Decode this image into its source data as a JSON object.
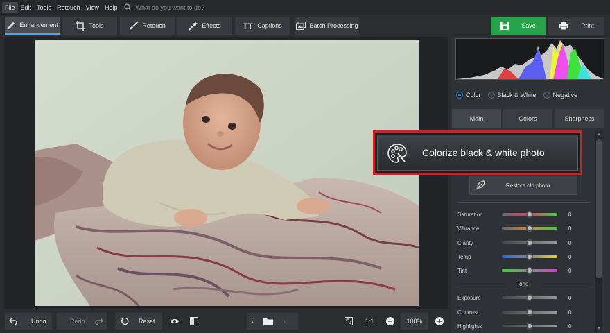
{
  "menubar": {
    "items": [
      "File",
      "Edit",
      "Tools",
      "Retouch",
      "View",
      "Help"
    ],
    "search_placeholder": "What do you want to do?"
  },
  "toolbar": {
    "tabs": [
      {
        "label": "Enhancement",
        "icon": "enhancement-icon",
        "active": true
      },
      {
        "label": "Tools",
        "icon": "crop-icon"
      },
      {
        "label": "Retouch",
        "icon": "brush-icon"
      },
      {
        "label": "Effects",
        "icon": "magic-wand-icon"
      },
      {
        "label": "Captions",
        "icon": "text-icon"
      }
    ],
    "batch_label": "Batch Processing",
    "save_label": "Save",
    "print_label": "Print"
  },
  "panel": {
    "modes": [
      {
        "label": "Color",
        "selected": true
      },
      {
        "label": "Black & White"
      },
      {
        "label": "Negative"
      }
    ],
    "subtabs": [
      "Main",
      "Colors",
      "Sharpness"
    ],
    "colorize_label": "Colorize black & white photo",
    "restore_label": "Restore old photo",
    "sliders": [
      {
        "label": "Saturation",
        "value": "0"
      },
      {
        "label": "Vibrance",
        "value": "0"
      },
      {
        "label": "Clarity",
        "value": "0"
      },
      {
        "label": "Temp",
        "value": "0"
      },
      {
        "label": "Tint",
        "value": "0"
      }
    ],
    "tone_label": "Tone",
    "tone_sliders": [
      {
        "label": "Exposure",
        "value": "0"
      },
      {
        "label": "Contrast",
        "value": "0"
      },
      {
        "label": "Highlights",
        "value": "0"
      }
    ]
  },
  "bottombar": {
    "undo_label": "Undo",
    "redo_label": "Redo",
    "reset_label": "Reset",
    "ratio_label": "1:1",
    "zoom_value": "100%"
  },
  "colors": {
    "accent_blue": "#4aa2f0",
    "save_green": "#24a34a",
    "callout_red": "#d42020"
  }
}
